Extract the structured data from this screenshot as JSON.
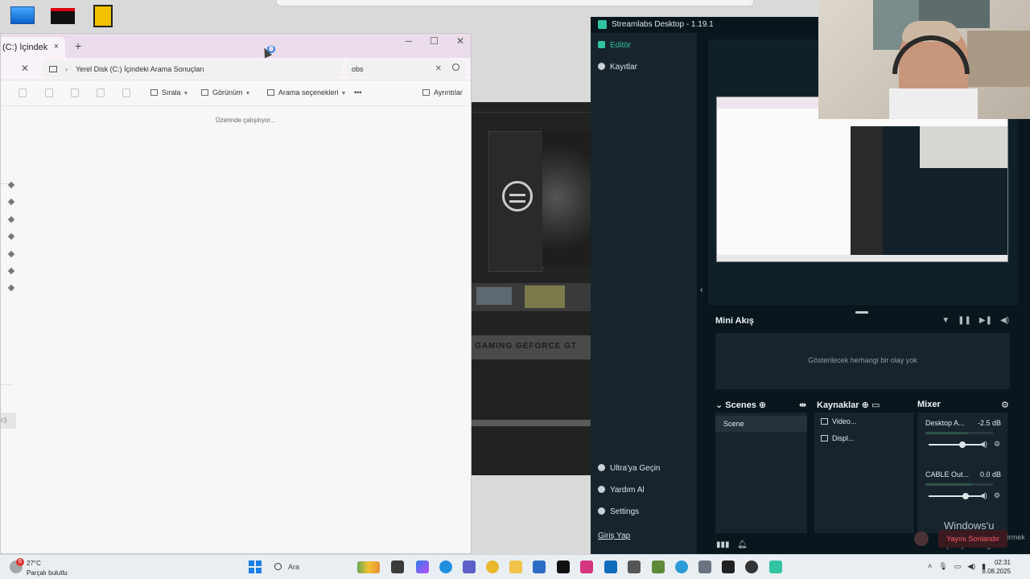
{
  "explorer": {
    "tab_label": "(C:) İçindeki Ar",
    "tab_close": "×",
    "new_tab": "+",
    "address_path": "Yerel Disk (C:) İçindeki Arama Sonuçları",
    "search_value": "obs",
    "toolbar": {
      "sort": "Sırala",
      "view": "Görünüm",
      "search_options": "Arama seçenekleri",
      "more": "•••",
      "details": "Ayrıntılar"
    },
    "status": "Üzerinde çalışılıyor...",
    "nav_sel_label": "ı:)"
  },
  "wallpaper": {
    "gpu_text": "GAMING   GEFORCE GT"
  },
  "streamlabs": {
    "title": "Streamlabs Desktop - 1.19.1",
    "nav": {
      "editor": "Editör",
      "recordings": "Kayıtlar",
      "ultra": "Ultra'ya Geçin",
      "help": "Yardım Al",
      "settings": "Settings",
      "login": "Giriş Yap"
    },
    "mini_feed": {
      "title": "Mini Akış",
      "empty": "Gösterilecek herhangi bir olay yok"
    },
    "scenes": {
      "title": "Scenes",
      "items": [
        "Scene"
      ]
    },
    "sources": {
      "title": "Kaynaklar",
      "items": [
        "Video...",
        "Displ..."
      ]
    },
    "mixer": {
      "title": "Mixer",
      "channels": [
        {
          "name": "Desktop A...",
          "value": "-2.5 dB",
          "level": 0.62
        },
        {
          "name": "CABLE Out...",
          "value": "0.0 dB",
          "level": 0.68
        }
      ]
    },
    "activate": {
      "title": "Windows'u Etkinleştir",
      "subtitle": "Windows'u etkinleştirmek için Ayarlar'a gidin."
    },
    "stop_stream": "Yayını Sonlandır"
  },
  "taskbar": {
    "weather_badge": "6",
    "temperature": "27°C",
    "condition": "Parçalı bulutlu",
    "search_placeholder": "Ara",
    "time": "02:31",
    "date": "8.08.2025"
  }
}
